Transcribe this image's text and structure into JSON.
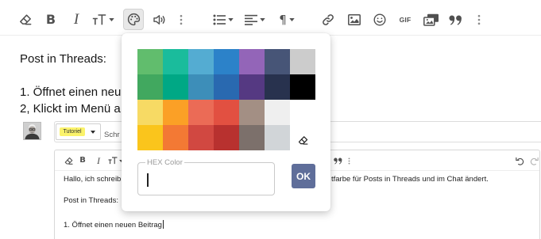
{
  "toolbar": {
    "icons": [
      "eraser-icon",
      "text-size-icon",
      "palette-icon",
      "speaker-icon",
      "more-vertical-icon",
      "bulleted-list-icon",
      "align-left-icon",
      "paragraph-icon",
      "link-icon",
      "image-icon",
      "smiley-icon",
      "media-icon",
      "quote-icon"
    ],
    "bold_label": "B",
    "italic_label": "I",
    "paragraph_glyph": "¶",
    "gif_label": "GIF"
  },
  "editor": {
    "line_1": "Post in Threads:",
    "line_2": "1. Öffnet einen neu",
    "line_3": "2, Klickt im Menü a"
  },
  "embedded_editor": {
    "prefix_label": "Tutoriel",
    "title_fragment": "Schr",
    "toolbar": {
      "bold_label": "B",
      "italic_label": "I",
      "icons": [
        "eraser-icon",
        "text-size-icon",
        "quote-icon",
        "more-vertical-icon",
        "undo-icon",
        "redo-icon"
      ]
    },
    "text_line_1_start": "Hallo, ich schreib",
    "text_line_1_end": "tfarbe für Posts in Threads und im Chat ändert.",
    "text_line_2": "Post in Threads:",
    "text_line_3": "1. Öffnet einen neuen Beitrag"
  },
  "color_popup": {
    "colors": [
      "#61BD6D",
      "#1ABC9C",
      "#54ACD2",
      "#2C82C9",
      "#9365B8",
      "#475577",
      "#CCCCCC",
      "#41A85F",
      "#00A885",
      "#3D8EB9",
      "#2969B0",
      "#553982",
      "#28324E",
      "#000000",
      "#F7DA64",
      "#FBA026",
      "#EB6B56",
      "#E25041",
      "#A38F84",
      "#EFEFEF",
      "#FFFFFF",
      "#FAC51C",
      "#F37934",
      "#D14841",
      "#B8312F",
      "#7C706B",
      "#D1D5D8"
    ],
    "remove_icon": "eraser-icon",
    "hex_label": "HEX Color",
    "hex_value": "",
    "ok_label": "OK"
  },
  "theme": {
    "icon_color": "#505050",
    "accent": "#5F6E9A",
    "prefix_badge": "#FBF36B",
    "active_button_bg": "#E8E8E8"
  }
}
